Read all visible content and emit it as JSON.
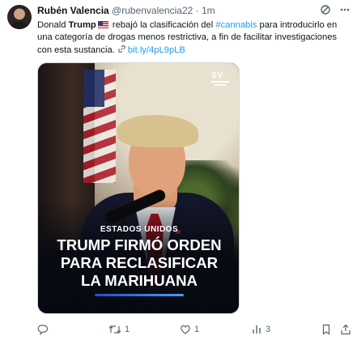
{
  "tweet": {
    "author_name": "Rubén Valencia",
    "handle": "@rubenvalencia22",
    "separator": "·",
    "time": "1m",
    "text": {
      "part1": "Donald ",
      "bold": "Trump",
      "part2": " rebajó la clasificación del ",
      "hashtag": "#cannabis",
      "part3": " para introducirlo en una categoría de drogas menos restrictiva, a fin de facilitar investigaciones con esta sustancia. ",
      "link": "bit.ly/4pL9pLB"
    },
    "flag_emoji": "us-flag",
    "media": {
      "logo": "SV",
      "kicker": "ESTADOS UNIDOS",
      "headline_line1": "TRUMP FIRMÓ ORDEN",
      "headline_line2": "PARA RECLASIFICAR",
      "headline_line3": "LA MARIHUANA"
    },
    "actions": {
      "reply_count": "",
      "retweet_count": "1",
      "like_count": "1",
      "views_count": "3"
    }
  },
  "icons": [
    "grok-icon",
    "more-icon",
    "link-icon",
    "reply-icon",
    "retweet-icon",
    "like-icon",
    "views-icon",
    "bookmark-icon"
  ],
  "colors": {
    "accent": "#1d9bf0",
    "secondary_text": "#536471",
    "text": "#0f1419"
  }
}
